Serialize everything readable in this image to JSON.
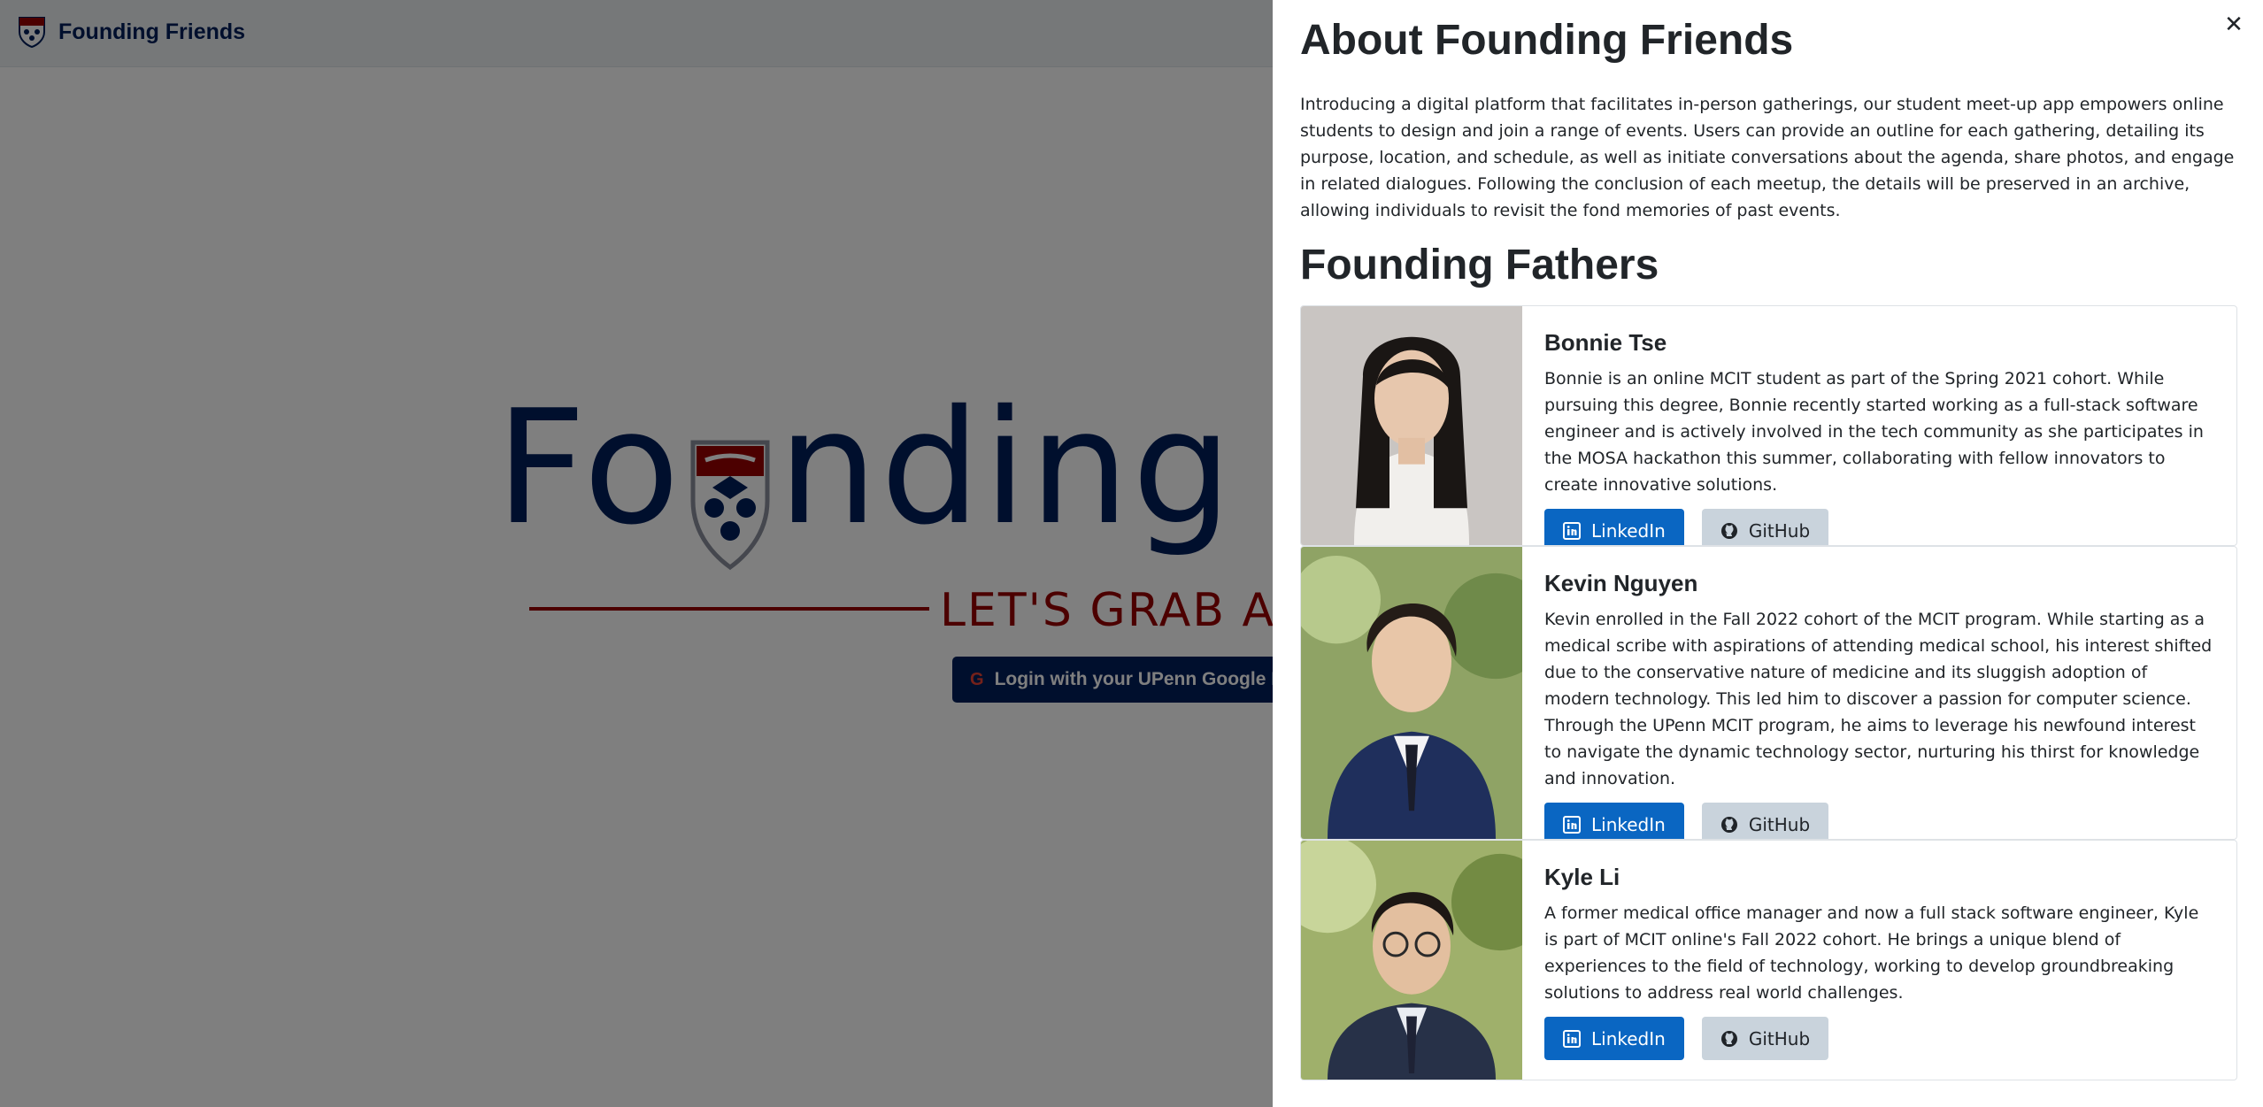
{
  "navbar": {
    "brand_name": "Founding Friends",
    "logo_icon": "penn-shield-icon"
  },
  "hero": {
    "wordmark_left": "Fo",
    "wordmark_right": "nding F",
    "tagline": "LET'S GRAB A BY",
    "login_label": "Login with your UPenn Google Em",
    "google_glyph": "G"
  },
  "panel": {
    "close_glyph": "✕",
    "title": "About Founding Friends",
    "intro": "Introducing a digital platform that facilitates in-person gatherings, our student meet-up app empowers online students to design and join a range of events. Users can provide an outline for each gathering, detailing its purpose, location, and schedule, as well as initiate conversations about the agenda, share photos, and engage in related dialogues. Following the conclusion of each meetup, the details will be preserved in an archive, allowing individuals to revisit the fond memories of past events.",
    "subtitle": "Founding Fathers",
    "members": [
      {
        "name": "Bonnie Tse",
        "bio": "Bonnie is an online MCIT student as part of the Spring 2021 cohort. While pursuing this degree, Bonnie recently started working as a full-stack software engineer and is actively involved in the tech community as she participates in the MOSA hackathon this summer, collaborating with fellow innovators to create innovative solutions.",
        "linkedin_label": "LinkedIn",
        "github_label": "GitHub"
      },
      {
        "name": "Kevin Nguyen",
        "bio": "Kevin enrolled in the Fall 2022 cohort of the MCIT program. While starting as a medical scribe with aspirations of attending medical school, his interest shifted due to the conservative nature of medicine and its sluggish adoption of modern technology. This led him to discover a passion for computer science. Through the UPenn MCIT program, he aims to leverage his newfound interest to navigate the dynamic technology sector, nurturing his thirst for knowledge and innovation.",
        "linkedin_label": "LinkedIn",
        "github_label": "GitHub"
      },
      {
        "name": "Kyle Li",
        "bio": "A former medical office manager and now a full stack software engineer, Kyle is part of MCIT online's Fall 2022 cohort. He brings a unique blend of experiences to the field of technology, working to develop groundbreaking solutions to address real world challenges.",
        "linkedin_label": "LinkedIn",
        "github_label": "GitHub"
      }
    ]
  },
  "colors": {
    "penn_blue": "#011f5b",
    "penn_red": "#990000",
    "linkedin_blue": "#0a66c2",
    "github_gray": "#c9d3dc"
  }
}
